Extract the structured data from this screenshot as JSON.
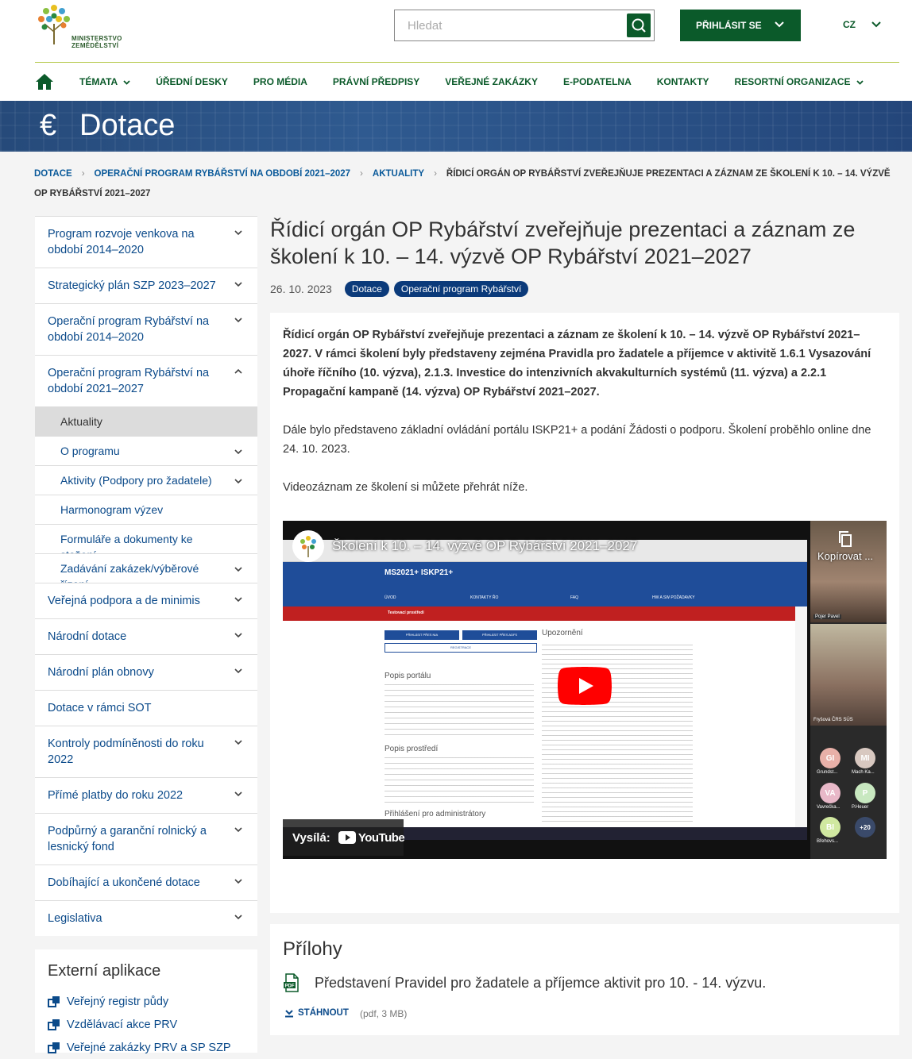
{
  "header": {
    "logo_text": "MINISTERSTVO ZEMĚDĚLSTVÍ",
    "search_placeholder": "Hledat",
    "login_label": "PŘIHLÁSIT SE",
    "lang_label": "CZ"
  },
  "nav": {
    "items": [
      {
        "label": "TÉMATA",
        "dropdown": true
      },
      {
        "label": "ÚŘEDNÍ DESKY",
        "dropdown": false
      },
      {
        "label": "PRO MÉDIA",
        "dropdown": false
      },
      {
        "label": "PRÁVNÍ PŘEDPISY",
        "dropdown": false
      },
      {
        "label": "VEŘEJNÉ ZAKÁZKY",
        "dropdown": false
      },
      {
        "label": "E-PODATELNA",
        "dropdown": false
      },
      {
        "label": "KONTAKTY",
        "dropdown": false
      },
      {
        "label": "RESORTNÍ ORGANIZACE",
        "dropdown": true
      }
    ]
  },
  "banner": {
    "icon": "€",
    "title": "Dotace"
  },
  "breadcrumb": {
    "items": [
      "DOTACE",
      "OPERAČNÍ PROGRAM RYBÁŘSTVÍ NA OBDOBÍ 2021–2027",
      "AKTUALITY"
    ],
    "current": "ŘÍDICÍ ORGÁN OP RYBÁŘSTVÍ ZVEŘEJŇUJE PREZENTACI A ZÁZNAM ZE ŠKOLENÍ K 10. – 14. VÝZVĚ OP RYBÁŘSTVÍ 2021–2027"
  },
  "sidebar": {
    "top_items": [
      {
        "label": "Program rozvoje venkova na období 2014–2020"
      },
      {
        "label": "Strategický plán SZP 2023–2027"
      },
      {
        "label": "Operační program Rybářství na období 2014–2020"
      },
      {
        "label": "Operační program Rybářství na období 2021–2027"
      }
    ],
    "sub_items": [
      {
        "label": "Aktuality",
        "active": true,
        "chevron": false
      },
      {
        "label": "O programu",
        "active": false,
        "chevron": true
      },
      {
        "label": "Aktivity (Podpory pro žadatele)",
        "active": false,
        "chevron": true
      },
      {
        "label": "Harmonogram výzev",
        "active": false,
        "chevron": false
      },
      {
        "label": "Formuláře a dokumenty ke stažení",
        "active": false,
        "chevron": false
      },
      {
        "label": "Zadávání zakázek/výběrové řízení",
        "active": false,
        "chevron": true
      }
    ],
    "bottom_items": [
      {
        "label": "Veřejná podpora a de minimis",
        "chevron": true
      },
      {
        "label": "Národní dotace",
        "chevron": true
      },
      {
        "label": "Národní plán obnovy",
        "chevron": true
      },
      {
        "label": "Dotace v rámci SOT",
        "chevron": false
      },
      {
        "label": "Kontroly podmíněnosti do roku 2022",
        "chevron": true
      },
      {
        "label": "Přímé platby do roku 2022",
        "chevron": true
      },
      {
        "label": "Podpůrný a garanční rolnický a lesnický fond",
        "chevron": true
      },
      {
        "label": "Dobíhající a ukončené dotace",
        "chevron": true
      },
      {
        "label": "Legislativa",
        "chevron": true
      }
    ]
  },
  "external_apps": {
    "title": "Externí aplikace",
    "items": [
      "Veřejný registr půdy",
      "Vzdělávací akce PRV",
      "Veřejné zakázky PRV a SP SZP"
    ]
  },
  "article": {
    "title": "Řídicí orgán OP Rybářství zveřejňuje prezentaci a záznam ze školení k 10. – 14. výzvě OP Rybářství 2021–2027",
    "date": "26. 10. 2023",
    "tags": [
      "Dotace",
      "Operační program Rybářství"
    ],
    "lead": "Řídicí orgán OP Rybářství zveřejňuje prezentaci a záznam ze školení k 10. – 14. výzvě OP Rybářství 2021–2027. V rámci školení byly představeny zejména Pravidla pro žadatele a příjemce v aktivitě 1.6.1 Vysazování úhoře říčního (10. výzva), 2.1.3. Investice do intenzivních akvakulturních systémů (11. výzva) a 2.2.1 Propagační kampaně (14. výzva) OP Rybářství 2021–2027.",
    "para1": "Dále bylo představeno základní ovládání portálu ISKP21+ a podání Žádosti o podporu. Školení proběhlo online dne 24. 10. 2023.",
    "para2": "Videozáznam ze školení si můžete přehrát níže."
  },
  "video": {
    "title": "Školení k 10. – 14. výzvě OP Rybářství 2021–2027",
    "copy_label": "Kopírovat ...",
    "watch_on": "Vysílá:",
    "youtube": "YouTube",
    "site_title": "MS2021+ ISKP21+",
    "site_nav": [
      "ÚVOD",
      "KONTAKTY ŘO",
      "FAQ",
      "HW A SW POŽADAVKY"
    ],
    "site_bar": "Testovací prostředí",
    "btn_nia": "PŘIHLÁSIT PŘES NIA",
    "btn_adfs": "PŘIHLÁSIT PŘES ADFS",
    "btn_reg": "REGISTRACE",
    "h_popis": "Popis portálu",
    "h_prostredi": "Popis prostředí",
    "h_prihlaseni": "Přihlášení pro administrátory",
    "h_upozorneni": "Upozornění",
    "cam1_name": "Pojer Pavel",
    "cam2_name": "Fryšová ČRS SÚS",
    "participants": [
      {
        "initials": "GI",
        "name": "Grundst...",
        "color": "#e8b0a8"
      },
      {
        "initials": "MI",
        "name": "Mach Ka...",
        "color": "#d8c8c0"
      },
      {
        "initials": "VA",
        "name": "Vavrečka...",
        "color": "#e8b8c8"
      },
      {
        "initials": "P",
        "name": "P.Heuer",
        "color": "#c8e8c0"
      },
      {
        "initials": "BI",
        "name": "Břehovs...",
        "color": "#d0e8a0"
      },
      {
        "initials": "+20",
        "name": "",
        "color": "#3a4a6a"
      }
    ]
  },
  "attachments": {
    "title": "Přílohy",
    "file_name": "Představení Pravidel pro žadatele a příjemce aktivit pro 10. - 14. výzvu.",
    "download_label": "STÁHNOUT",
    "file_meta": "(pdf, 3 MB)",
    "file_type": "PDF"
  },
  "colors": {
    "brand_green": "#0b5a2a",
    "link_blue": "#0b4a8a",
    "tag_blue": "#0b3a7a",
    "youtube_red": "#ff0000"
  }
}
